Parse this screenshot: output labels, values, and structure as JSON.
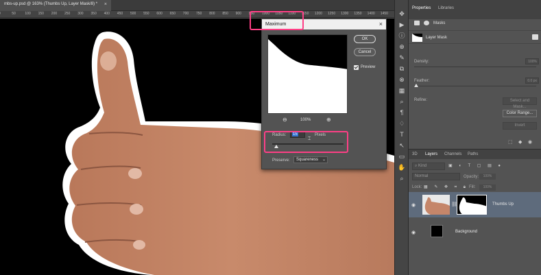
{
  "document": {
    "tab_title": "mbs-up.psd @ 163% (Thumbs Up, Layer Mask/8) *",
    "tab_close": "×",
    "ruler_ticks": [
      "0",
      "50",
      "100",
      "150",
      "200",
      "250",
      "300",
      "350",
      "400",
      "450",
      "500",
      "550",
      "600",
      "650",
      "700",
      "750",
      "800",
      "850",
      "900",
      "950",
      "1000",
      "1050",
      "1100",
      "1150",
      "1200",
      "1250",
      "1300",
      "1350",
      "1400",
      "1450"
    ]
  },
  "dialog": {
    "title": "Maximum",
    "close": "×",
    "ok": "OK",
    "cancel": "Cancel",
    "preview_label": "Preview",
    "preview_checked": true,
    "zoom_out": "⊖",
    "zoom_in": "⊕",
    "zoom_level": "100%",
    "radius_label": "Radius:",
    "radius_value": "15",
    "radius_unit": "Pixels",
    "preserve_label": "Preserve:",
    "preserve_value": "Squareness",
    "highlight_color": "#ff3f86"
  },
  "toolbar": {
    "icons": [
      "move-tool-icon",
      "rect-select-icon",
      "lasso-icon",
      "crop-icon",
      "eyedropper-icon",
      "brush-icon",
      "stamp-icon",
      "eraser-icon",
      "gradient-icon",
      "dodge-icon",
      "pen-icon",
      "type-icon",
      "path-select-icon",
      "shape-icon",
      "hand-icon",
      "zoom-icon"
    ],
    "glyphs": [
      "✥",
      "▶",
      "ⓘ",
      "⊕",
      "✎",
      "⧉",
      "⊗",
      "▦",
      "⌕",
      "¶",
      "♢",
      "T",
      "↖",
      "▭",
      "✋",
      "⌕"
    ]
  },
  "properties": {
    "tab_properties": "Properties",
    "tab_libraries": "Libraries",
    "masks_label": "Masks",
    "layer_mask_label": "Layer Mask",
    "density_label": "Density:",
    "density_value": "100%",
    "feather_label": "Feather:",
    "feather_value": "0.0 px",
    "refine_label": "Refine:",
    "select_and_mask": "Select and Mask...",
    "color_range": "Color Range...",
    "invert": "Invert"
  },
  "layers": {
    "tab_3d": "3D",
    "tab_layers": "Layers",
    "tab_channels": "Channels",
    "tab_paths": "Paths",
    "kind_label": "Kind",
    "blend_mode": "Normal",
    "opacity_label": "Opacity:",
    "opacity_value": "100%",
    "lock_label": "Lock:",
    "fill_label": "Fill:",
    "fill_value": "100%",
    "items": [
      {
        "name": "Thumbs Up",
        "selected": true
      },
      {
        "name": "Background",
        "selected": false
      }
    ]
  }
}
